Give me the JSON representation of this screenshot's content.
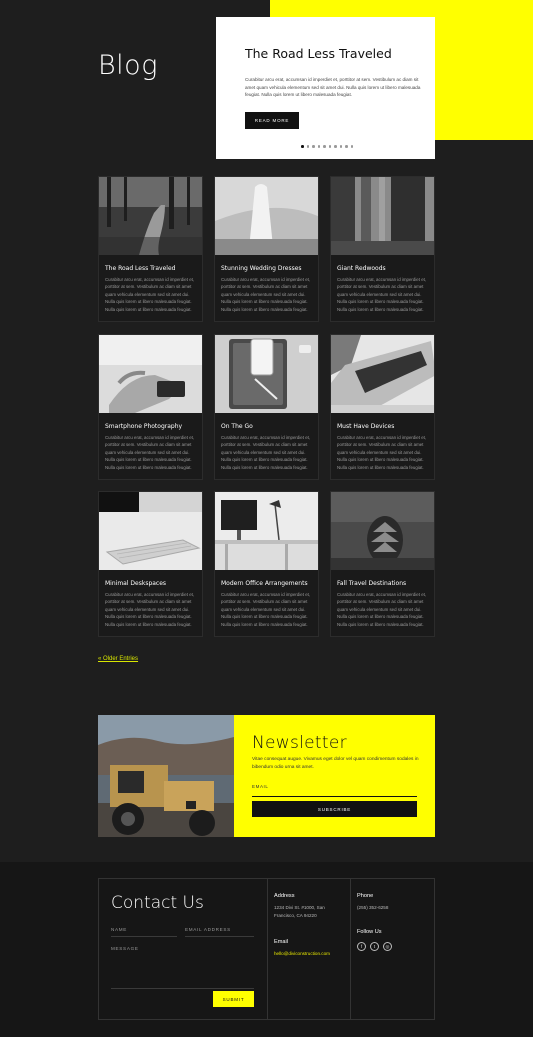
{
  "hero": {
    "title": "Blog",
    "feature": {
      "title": "The Road Less Traveled",
      "excerpt": "Curabitur arcu erat, accumsan id imperdiet et, porttitor at sem. Vestibulum ac diam sit amet quam vehicula elementum sed sit amet dui. Nulla quis lorem ut libero malesuada feugiat. Nulla quis lorem ut libero malesuada feugiat.",
      "button_label": "READ MORE",
      "slides_count": 10,
      "active_slide": 1
    }
  },
  "posts": [
    {
      "title": "The Road Less Traveled",
      "excerpt": "Curabitur arcu erat, accumsan id imperdiet et, porttitor at sem. Vestibulum ac diam sit amet quam vehicula elementum sed sit amet dui. Nulla quis lorem ut libero malesuada feugiat. Nulla quis lorem ut libero malesuada feugiat.",
      "image": "forest-path"
    },
    {
      "title": "Stunning Wedding Dresses",
      "excerpt": "Curabitur arcu erat, accumsan id imperdiet et, porttitor at sem. Vestibulum ac diam sit amet quam vehicula elementum sed sit amet dui. Nulla quis lorem ut libero malesuada feugiat. Nulla quis lorem ut libero malesuada feugiat.",
      "image": "wedding-dress"
    },
    {
      "title": "Giant Redwoods",
      "excerpt": "Curabitur arcu erat, accumsan id imperdiet et, porttitor at sem. Vestibulum ac diam sit amet quam vehicula elementum sed sit amet dui. Nulla quis lorem ut libero malesuada feugiat. Nulla quis lorem ut libero malesuada feugiat.",
      "image": "redwoods"
    },
    {
      "title": "Smartphone Photography",
      "excerpt": "Curabitur arcu erat, accumsan id imperdiet et, porttitor at sem. Vestibulum ac diam sit amet quam vehicula elementum sed sit amet dui. Nulla quis lorem ut libero malesuada feugiat. Nulla quis lorem ut libero malesuada feugiat.",
      "image": "hands-phone"
    },
    {
      "title": "On The Go",
      "excerpt": "Curabitur arcu erat, accumsan id imperdiet et, porttitor at sem. Vestibulum ac diam sit amet quam vehicula elementum sed sit amet dui. Nulla quis lorem ut libero malesuada feugiat. Nulla quis lorem ut libero malesuada feugiat.",
      "image": "tablet-phone"
    },
    {
      "title": "Must Have Devices",
      "excerpt": "Curabitur arcu erat, accumsan id imperdiet et, porttitor at sem. Vestibulum ac diam sit amet quam vehicula elementum sed sit amet dui. Nulla quis lorem ut libero malesuada feugiat. Nulla quis lorem ut libero malesuada feugiat.",
      "image": "laptop"
    },
    {
      "title": "Minimal Deskspaces",
      "excerpt": "Curabitur arcu erat, accumsan id imperdiet et, porttitor at sem. Vestibulum ac diam sit amet quam vehicula elementum sed sit amet dui. Nulla quis lorem ut libero malesuada feugiat. Nulla quis lorem ut libero malesuada feugiat.",
      "image": "keyboard"
    },
    {
      "title": "Modern Office Arrangements",
      "excerpt": "Curabitur arcu erat, accumsan id imperdiet et, porttitor at sem. Vestibulum ac diam sit amet quam vehicula elementum sed sit amet dui. Nulla quis lorem ut libero malesuada feugiat. Nulla quis lorem ut libero malesuada feugiat.",
      "image": "office-desk"
    },
    {
      "title": "Fall Travel Destinations",
      "excerpt": "Curabitur arcu erat, accumsan id imperdiet et, porttitor at sem. Vestibulum ac diam sit amet quam vehicula elementum sed sit amet dui. Nulla quis lorem ut libero malesuada feugiat. Nulla quis lorem ut libero malesuada feugiat.",
      "image": "pinecone"
    }
  ],
  "pagination": {
    "older_label": "« Older Entries"
  },
  "newsletter": {
    "title": "Newsletter",
    "text": "Vitae consequat augue. Vivamus eget dolor vel quam condimentum sodales in bibendum odio urna sit amet.",
    "email_placeholder": "EMAIL",
    "subscribe_label": "SUBSCRIBE"
  },
  "contact": {
    "title": "Contact Us",
    "name_placeholder": "NAME",
    "email_placeholder": "EMAIL ADDRESS",
    "message_placeholder": "MESSAGE",
    "submit_label": "SUBMIT",
    "address_heading": "Address",
    "address_line1": "1234 Divi St. #1000, San",
    "address_line2": "Francisco, CA 94220",
    "email_heading": "Email",
    "email_value": "hello@diviconstruction.com",
    "phone_heading": "Phone",
    "phone_value": "(255) 352-6258",
    "follow_heading": "Follow Us",
    "social": [
      "f",
      "t",
      "◎"
    ]
  },
  "colors": {
    "accent": "#ffff00",
    "background": "#1e1e1e",
    "footer": "#161616"
  }
}
